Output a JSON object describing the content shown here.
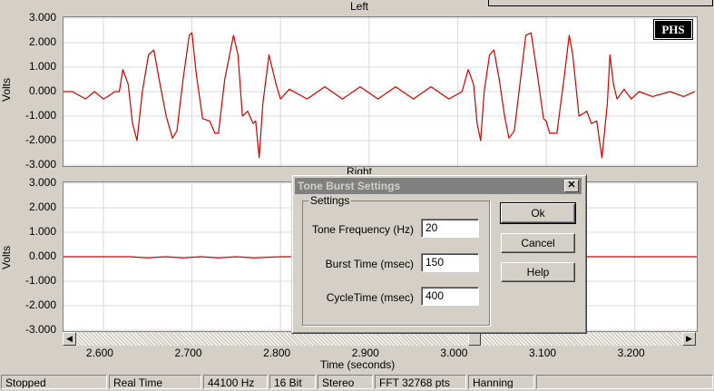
{
  "left_channel": {
    "title": "Left",
    "ylabel": "Volts",
    "yticks": [
      "3.000",
      "2.000",
      "1.000",
      "0.000",
      "-1.000",
      "-2.000",
      "-3.000"
    ],
    "badge": "PHS"
  },
  "right_channel": {
    "title": "Right",
    "ylabel": "Volts",
    "yticks": [
      "3.000",
      "2.000",
      "1.000",
      "0.000",
      "-1.000",
      "-2.000",
      "-3.000"
    ]
  },
  "x_axis": {
    "label": "Time (seconds)",
    "ticks": [
      "2.600",
      "2.700",
      "2.800",
      "2.900",
      "3.000",
      "3.100",
      "3.200"
    ]
  },
  "scrollbar": {
    "left_arrow": "◀",
    "right_arrow": "▶",
    "position": 0.66
  },
  "dialog": {
    "title": "Tone Burst Settings",
    "close_label": "✕",
    "group_label": "Settings",
    "fields": [
      {
        "label": "Tone Frequency (Hz)",
        "value": "20"
      },
      {
        "label": "Burst Time (msec)",
        "value": "150"
      },
      {
        "label": "CycleTime (msec)",
        "value": "400"
      }
    ],
    "buttons": {
      "ok": "Ok",
      "cancel": "Cancel",
      "help": "Help"
    }
  },
  "status_bar": [
    "Stopped",
    "Real Time",
    "44100 Hz",
    "16 Bit",
    "Stereo",
    "FFT 32768 pts",
    "Hanning",
    ""
  ],
  "colors": {
    "trace": "#cc0000",
    "grid": "#d8d8d8"
  },
  "chart_data": [
    {
      "type": "line",
      "title": "Left",
      "ylabel": "Volts",
      "xlabel": "Time (seconds)",
      "xlim": [
        2.555,
        3.27
      ],
      "ylim": [
        -3,
        3
      ],
      "grid": true,
      "series": [
        {
          "x": [
            2.555,
            2.565,
            2.58,
            2.59,
            2.6,
            2.605,
            2.613,
            2.618,
            2.622,
            2.628,
            2.633,
            2.638,
            2.644,
            2.651,
            2.657,
            2.663,
            2.671,
            2.678,
            2.683,
            2.69,
            2.697,
            2.7,
            2.705,
            2.712,
            2.72,
            2.726,
            2.73,
            2.737,
            2.747,
            2.752,
            2.757,
            2.763,
            2.769,
            2.772,
            2.776,
            2.78,
            2.787,
            2.795,
            2.8,
            2.81,
            2.83,
            2.85,
            2.87,
            2.89,
            2.91,
            2.93,
            2.95,
            2.97,
            2.99,
            3.005,
            3.012,
            3.018,
            3.022,
            3.026,
            3.03,
            3.036,
            3.041,
            3.047,
            3.053,
            3.058,
            3.064,
            3.071,
            3.077,
            3.083,
            3.09,
            3.097,
            3.1,
            3.104,
            3.112,
            3.12,
            3.126,
            3.13,
            3.137,
            3.146,
            3.151,
            3.157,
            3.163,
            3.169,
            3.172,
            3.176,
            3.18,
            3.188,
            3.196,
            3.205,
            3.22,
            3.24,
            3.255,
            3.268
          ],
          "y": [
            0.0,
            0.0,
            -0.3,
            0.0,
            -0.3,
            -0.2,
            0.0,
            0.0,
            0.9,
            0.3,
            -1.3,
            -2.0,
            0.0,
            1.5,
            1.7,
            0.5,
            -1.0,
            -1.9,
            -1.6,
            0.5,
            2.3,
            2.4,
            0.7,
            -1.1,
            -1.2,
            -1.7,
            -1.7,
            0.5,
            2.3,
            1.5,
            -1.0,
            -0.8,
            -1.3,
            -1.2,
            -2.7,
            -0.5,
            1.5,
            0.3,
            -0.3,
            0.1,
            -0.3,
            0.2,
            -0.3,
            0.2,
            -0.3,
            0.2,
            -0.3,
            0.2,
            -0.3,
            0.0,
            0.9,
            0.3,
            -1.3,
            -2.0,
            0.0,
            1.5,
            1.7,
            0.5,
            -1.0,
            -1.9,
            -1.6,
            0.5,
            2.3,
            2.4,
            0.7,
            -1.1,
            -1.2,
            -1.7,
            -1.7,
            0.5,
            2.3,
            1.5,
            -1.0,
            -0.8,
            -1.3,
            -1.2,
            -2.7,
            -0.5,
            1.5,
            0.3,
            -0.3,
            0.1,
            -0.3,
            0.0,
            -0.2,
            0.0,
            -0.2,
            0.0
          ]
        }
      ]
    },
    {
      "type": "line",
      "title": "Right",
      "ylabel": "Volts",
      "xlabel": "Time (seconds)",
      "xlim": [
        2.555,
        3.27
      ],
      "ylim": [
        -3,
        3
      ],
      "grid": true,
      "series": [
        {
          "x": [
            2.555,
            2.63,
            2.65,
            2.67,
            2.69,
            2.71,
            2.73,
            2.75,
            2.77,
            2.8,
            3.05,
            3.1,
            3.15,
            3.2,
            3.27
          ],
          "y": [
            0.0,
            0.0,
            -0.05,
            0.0,
            -0.05,
            0.0,
            -0.05,
            0.0,
            -0.05,
            0.0,
            0.0,
            0.0,
            0.0,
            0.0,
            0.0
          ]
        }
      ]
    }
  ]
}
